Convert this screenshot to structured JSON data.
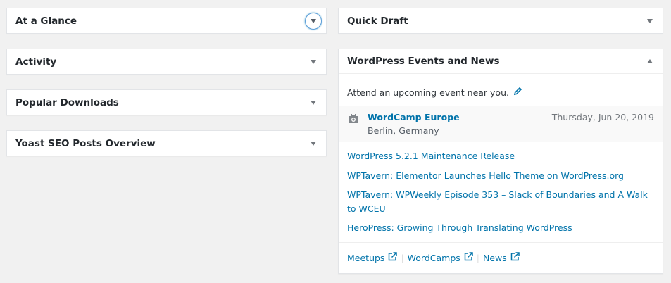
{
  "left_widgets": [
    {
      "title": "At a Glance"
    },
    {
      "title": "Activity"
    },
    {
      "title": "Popular Downloads"
    },
    {
      "title": "Yoast SEO Posts Overview"
    }
  ],
  "quick_draft": {
    "title": "Quick Draft"
  },
  "events": {
    "title": "WordPress Events and News",
    "intro": "Attend an upcoming event near you.",
    "event": {
      "title": "WordCamp Europe",
      "location": "Berlin, Germany",
      "date": "Thursday, Jun 20, 2019"
    },
    "news": [
      "WordPress 5.2.1 Maintenance Release",
      "WPTavern: Elementor Launches Hello Theme on WordPress.org",
      "WPTavern: WPWeekly Episode 353 – Slack of Boundaries and A Walk to WCEU",
      "HeroPress: Growing Through Translating WordPress"
    ],
    "footer_links": [
      "Meetups",
      "WordCamps",
      "News"
    ]
  },
  "colors": {
    "background": "#f1f1f1",
    "link": "#0073aa",
    "focus_ring": "#5b9dd9"
  }
}
